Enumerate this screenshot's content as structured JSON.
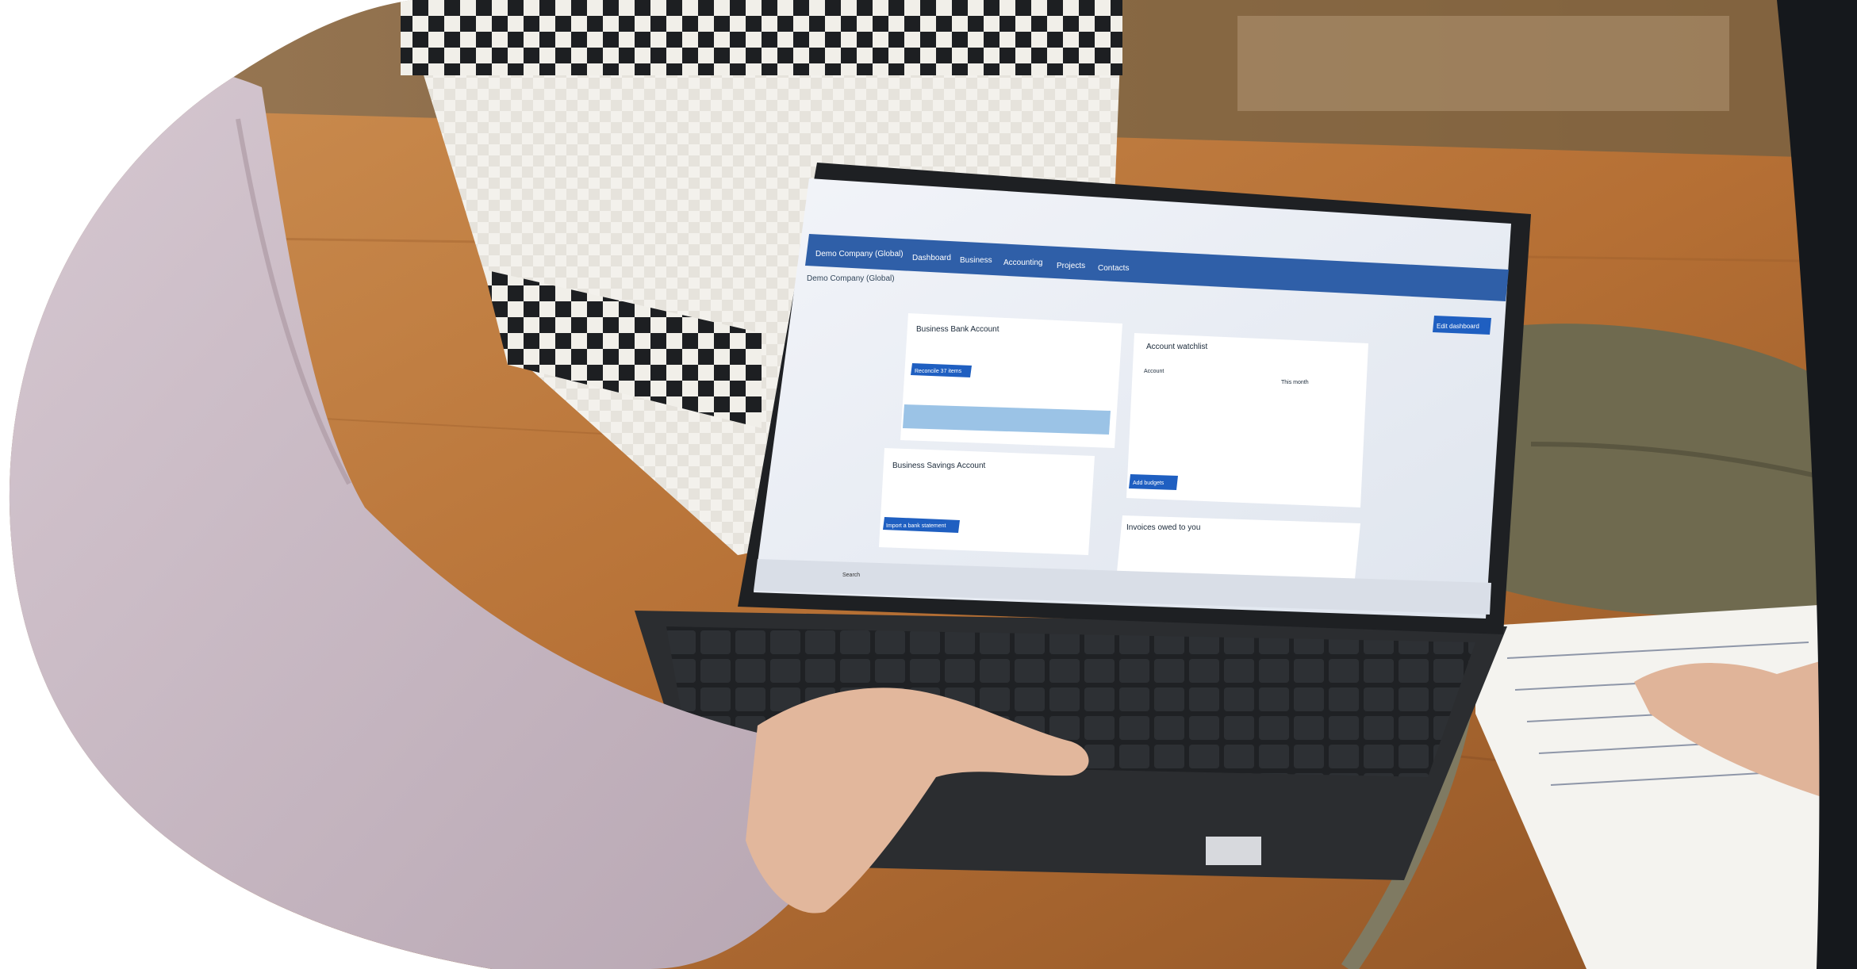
{
  "scene": {
    "description_free": true,
    "colors": {
      "background": "#ffffff",
      "table_wood": "#b9733a",
      "sleeve": "#cbbcc6",
      "laptop_body": "#2b2d30",
      "screen_bg": "#e9edf4",
      "app_nav": "#2f5fa8",
      "basket_white": "#f1efe9",
      "basket_check": "#1d1f22",
      "bag_olive": "#6f6a4f"
    }
  },
  "screen": {
    "nav": {
      "org": "Demo Company (Global)",
      "items": [
        "Dashboard",
        "Business",
        "Accounting",
        "Projects",
        "Contacts"
      ]
    },
    "org_title": "Demo Company (Global)",
    "edit_dashboard": "Edit dashboard",
    "bank_card": {
      "title": "Business Bank Account",
      "button": "Reconcile 37 items"
    },
    "savings_card": {
      "title": "Business Savings Account",
      "button": "Import a bank statement"
    },
    "watchlist": {
      "title": "Account watchlist",
      "col_account": "Account",
      "col_month": "This month",
      "add_button": "Add budgets"
    },
    "invoices": {
      "title": "Invoices owed to you"
    },
    "taskbar_search": "Search"
  }
}
